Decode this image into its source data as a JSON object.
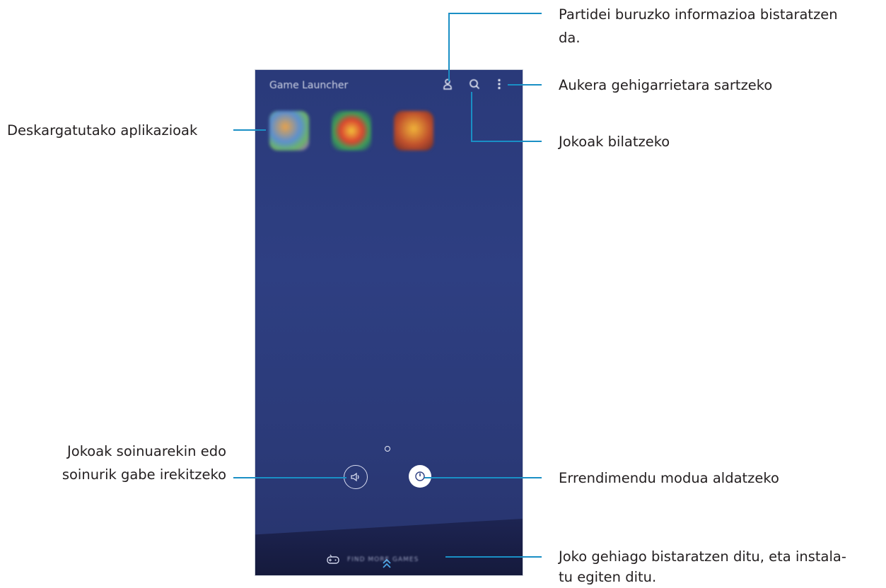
{
  "phone": {
    "app_title": "Game Launcher",
    "apps": [
      {
        "label": ""
      },
      {
        "label": ""
      },
      {
        "label": ""
      }
    ],
    "mute_label": "",
    "perf_label": "",
    "find_more": "FIND MORE GAMES"
  },
  "callouts": {
    "profile_line1": "Partidei buruzko informazioa bistaratzen",
    "profile_line2": "da.",
    "more_options": "Aukera gehigarrietara sartzeko",
    "search": "Jokoak bilatzeko",
    "downloaded": "Deskargatutako aplikazioak",
    "sound_line1": "Jokoak soinuarekin edo",
    "sound_line2": "soinurik gabe irekitzeko",
    "performance": "Errendimendu modua aldatzeko",
    "more_games_line1": "Joko gehiago bistaratzen ditu, eta instala-",
    "more_games_line2": "tu egiten ditu."
  },
  "colors": {
    "accent_line": "#1a8fc5",
    "screen_bg": "#2e3f82"
  },
  "icons": [
    "person-icon",
    "search-icon",
    "more-vert-icon",
    "speaker-icon",
    "performance-icon",
    "chevron-up-icon",
    "gamepad-icon"
  ]
}
